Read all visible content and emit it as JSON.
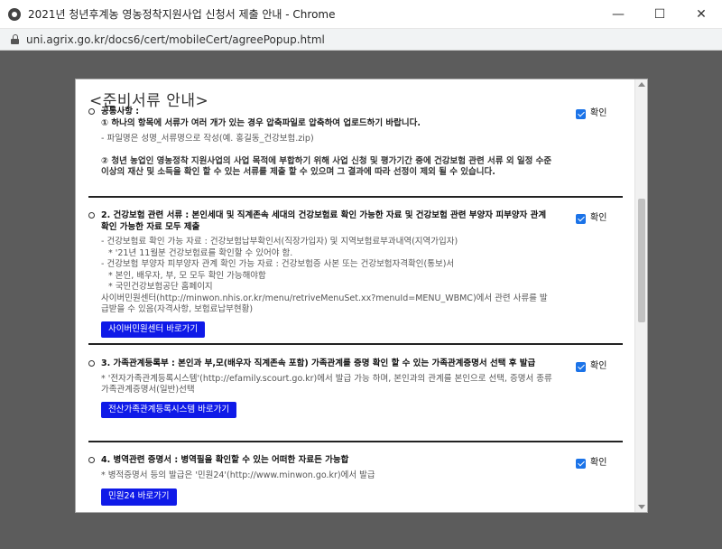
{
  "window": {
    "title": "2021년 청년후계농 영농정착지원사업 신청서 제출 안내 - Chrome",
    "minimize": "—",
    "maximize": "☐",
    "close": "✕"
  },
  "address": {
    "url": "uni.agrix.go.kr/docs6/cert/mobileCert/agreePopup.html"
  },
  "popup": {
    "title": "<준비서류 안내>",
    "confirm_label": "확인",
    "sections": [
      {
        "heading_1": "공통사항 :",
        "heading_2": "① 하나의 항목에 서류가 여러 개가 있는 경우 압축파일로 압축하여 업로드하기 바랍니다.",
        "note_1": "- 파일명은 성명_서류명으로 작성(예. 홍길동_건강보험.zip)",
        "note_2": "② 청년 농업인 영농정착 지원사업의 사업 목적에 부합하기 위해 사업 신청 및 평가기간 중에 건강보험 관련 서류 외 일정 수준 이상의 재산 및 소득을 확인 할 수 있는 서류를 제출 할 수 있으며 그 결과에 따라 선정이 제외 될 수 있습니다."
      },
      {
        "heading": "2. 건강보험 관련 서류 : 본인세대 및 직계존속 세대의 건강보험료 확인 가능한 자료 및 건강보험 관련 부양자 피부양자 관계 확인 가능한 자료 모두 제출",
        "line_1": "- 건강보험료 확인 가능 자료 : 건강보험납부확인서(직장가입자) 및 지역보험료부과내역(지역가입자)",
        "line_2": "* '21년 11월분 건강보험료를 확인할 수 있어야 함.",
        "line_3": "- 건강보험 부양자 피부양자 관계 확인 가능 자료 : 건강보험증 사본 또는 건강보험자격확인(통보)서",
        "line_4": "* 본인, 배우자, 부, 모 모두 확인 가능해야함",
        "line_5": "* 국민건강보험공단 홈페이지",
        "line_6": "사이버민원센터(http://minwon.nhis.or.kr/menu/retriveMenuSet.xx?menuId=MENU_WBMC)에서 관련 사류를 발급받을 수 있음(자격사항, 보험료납부현황)",
        "button": "사이버민원센터 바로가기"
      },
      {
        "heading": "3. 가족관계등록부 : 본인과 부,모(배우자 직계존속 포함) 가족관계를 증명 확인 할 수 있는 가족관계증명서 선택 후 발급",
        "line_1": "* '전자가족관계등록시스템'(http://efamily.scourt.go.kr)에서 발급 가능 하며, 본인과의 관계를 본인으로 선택, 증명서 종류 가족관계증명서(일반)선택",
        "button": "전산가족관계등록시스템 바로가기"
      },
      {
        "heading": "4. 병역관련 증명서 : 병역필을 확인할 수 있는 어떠한 자료든 가능합",
        "line_1": "* 병적증명서 등의 발급은 '민원24'(http://www.minwon.go.kr)에서 발급",
        "button": "민원24 바로가기"
      }
    ]
  }
}
